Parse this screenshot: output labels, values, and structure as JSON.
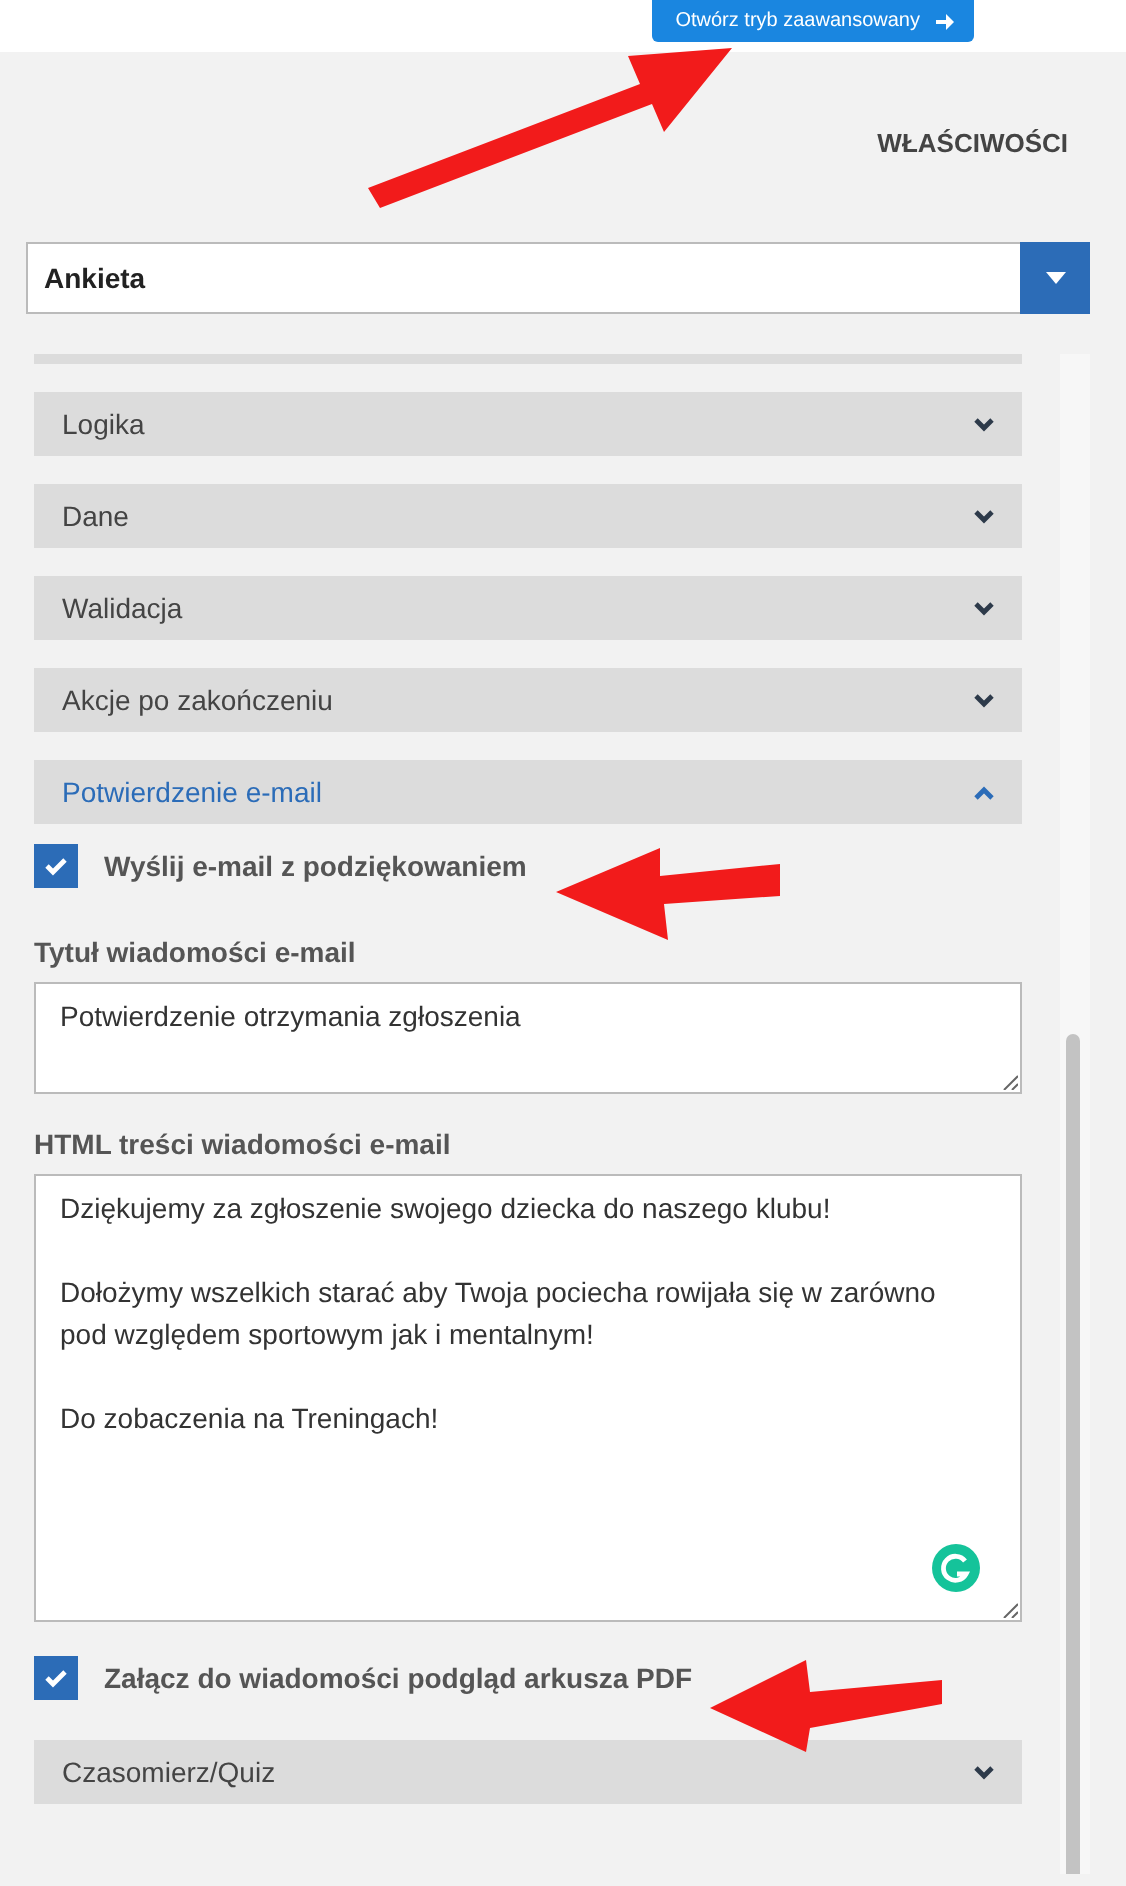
{
  "header": {
    "button": "Otwórz tryb zaawansowany"
  },
  "panel_title": "WŁAŚCIWOŚCI",
  "type_select": {
    "value": "Ankieta"
  },
  "sections": [
    {
      "label": "Logika",
      "expanded": false
    },
    {
      "label": "Dane",
      "expanded": false
    },
    {
      "label": "Walidacja",
      "expanded": false
    },
    {
      "label": "Akcje po zakończeniu",
      "expanded": false
    },
    {
      "label": "Potwierdzenie e-mail",
      "expanded": true,
      "content": [
        {
          "kind": "checkbox",
          "label": "Wyślij e-mail z podziękowaniem",
          "checked": true
        },
        {
          "kind": "textbox",
          "label": "Tytuł wiadomości e-mail",
          "value": "Potwierdzenie otrzymania zgłoszenia"
        },
        {
          "kind": "textarea",
          "label": "HTML treści wiadomości e-mail",
          "value": "Dziękujemy za zgłoszenie swojego dziecka do naszego klubu!\n\nDołożymy wszelkich starać aby Twoja pociecha rowijała się w zarówno pod względem sportowym jak i mentalnym!\n\nDo zobaczenia na Treningach!"
        },
        {
          "kind": "checkbox",
          "label": "Załącz do wiadomości podgląd arkusza PDF",
          "checked": true
        }
      ]
    },
    {
      "label": "Czasomierz/Quiz",
      "expanded": false
    }
  ]
}
